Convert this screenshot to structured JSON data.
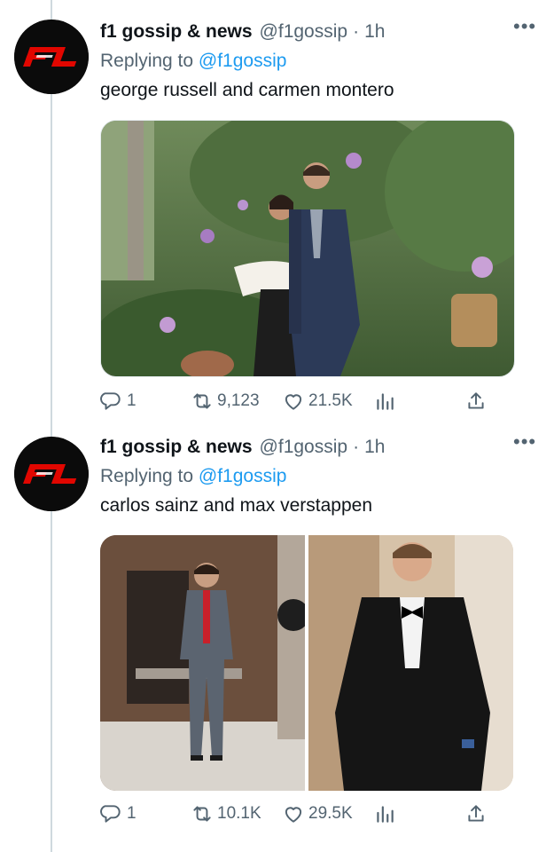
{
  "tweets": [
    {
      "display_name": "f1 gossip & news",
      "handle": "@f1gossip",
      "separator": "·",
      "time": "1h",
      "replying_prefix": "Replying to",
      "replying_handle": "@f1gossip",
      "text": "george russell and carmen montero",
      "replies": "1",
      "retweets": "9,123",
      "likes": "21.5K",
      "media": [
        "george russell and carmen montero photo"
      ]
    },
    {
      "display_name": "f1 gossip & news",
      "handle": "@f1gossip",
      "separator": "·",
      "time": "1h",
      "replying_prefix": "Replying to",
      "replying_handle": "@f1gossip",
      "text": "carlos sainz and max verstappen",
      "replies": "1",
      "retweets": "10.1K",
      "likes": "29.5K",
      "media": [
        "carlos sainz photo",
        "max verstappen photo"
      ]
    }
  ],
  "avatar_logo_text": "F1",
  "icons": {
    "more": "more-dots-icon",
    "reply": "reply-icon",
    "retweet": "retweet-icon",
    "like": "heart-icon",
    "analytics": "analytics-icon",
    "share": "share-icon"
  },
  "colors": {
    "link": "#1d9bf0",
    "muted": "#536471",
    "logo_red": "#e10600"
  }
}
